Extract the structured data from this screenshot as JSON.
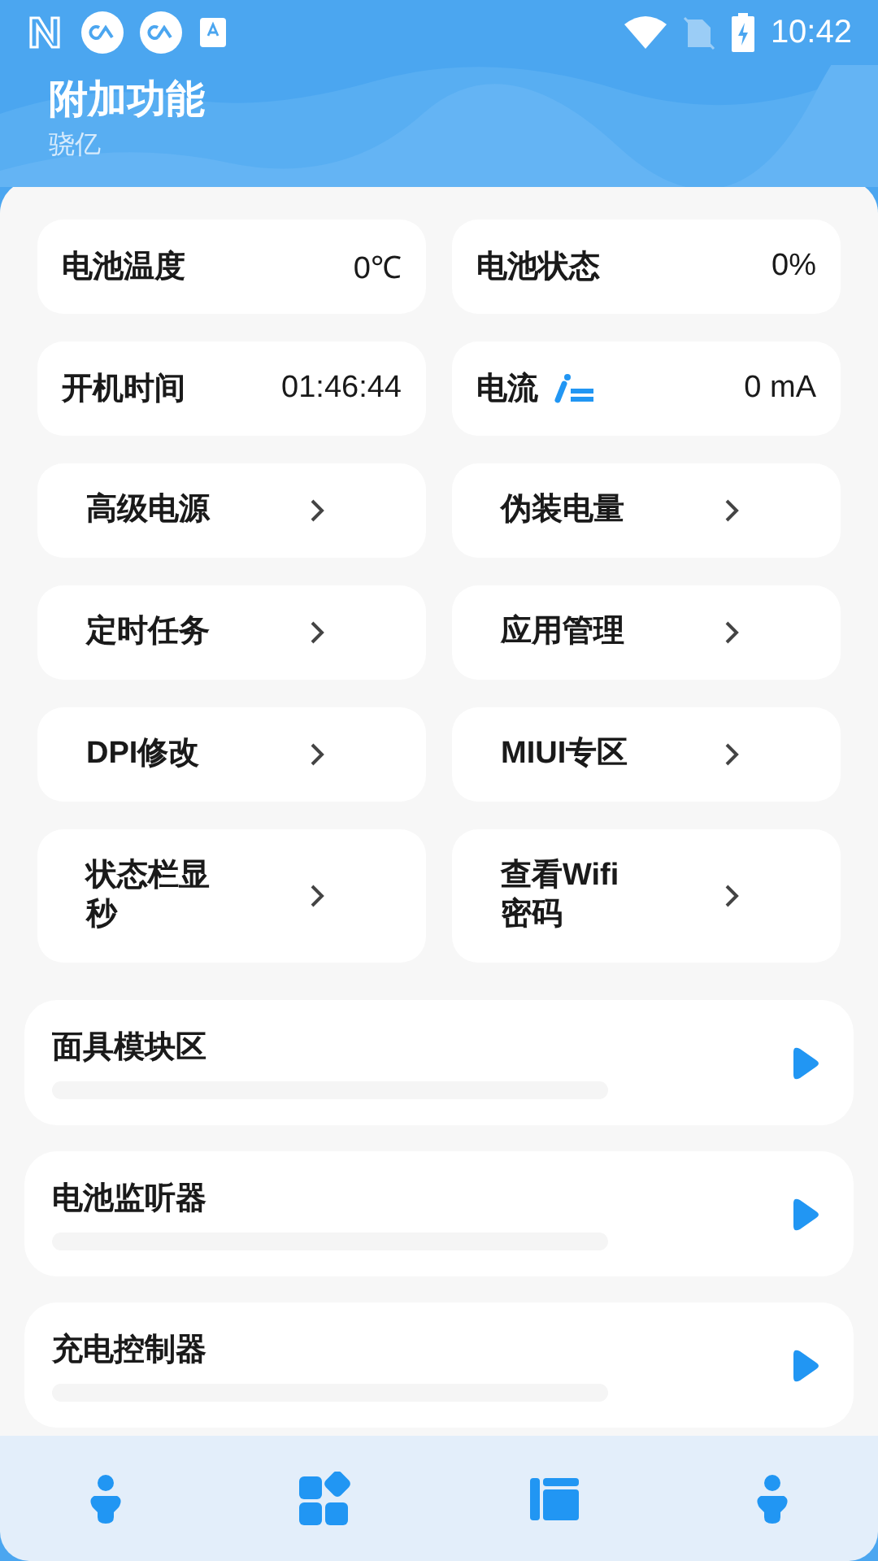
{
  "status_bar": {
    "time": "10:42"
  },
  "header": {
    "title": "附加功能",
    "subtitle": "骁亿"
  },
  "info_cards": [
    {
      "label": "电池温度",
      "value": "0℃",
      "has_icon": false
    },
    {
      "label": "电池状态",
      "value": "0%",
      "has_icon": false
    },
    {
      "label": "开机时间",
      "value": "01:46:44",
      "has_icon": false
    },
    {
      "label": "电流",
      "value": "0 mA",
      "has_icon": true
    }
  ],
  "nav_cards": [
    {
      "label": "高级电源"
    },
    {
      "label": "伪装电量"
    },
    {
      "label": "定时任务"
    },
    {
      "label": "应用管理"
    },
    {
      "label": "DPI修改"
    },
    {
      "label": "MIUI专区"
    },
    {
      "label": "状态栏显秒"
    },
    {
      "label": "查看Wifi密码"
    }
  ],
  "modules": [
    {
      "title": "面具模块区"
    },
    {
      "title": "电池监听器"
    },
    {
      "title": "充电控制器"
    }
  ],
  "bottom_nav": [
    {
      "kind": "person"
    },
    {
      "kind": "apps"
    },
    {
      "kind": "panel"
    },
    {
      "kind": "person"
    }
  ]
}
